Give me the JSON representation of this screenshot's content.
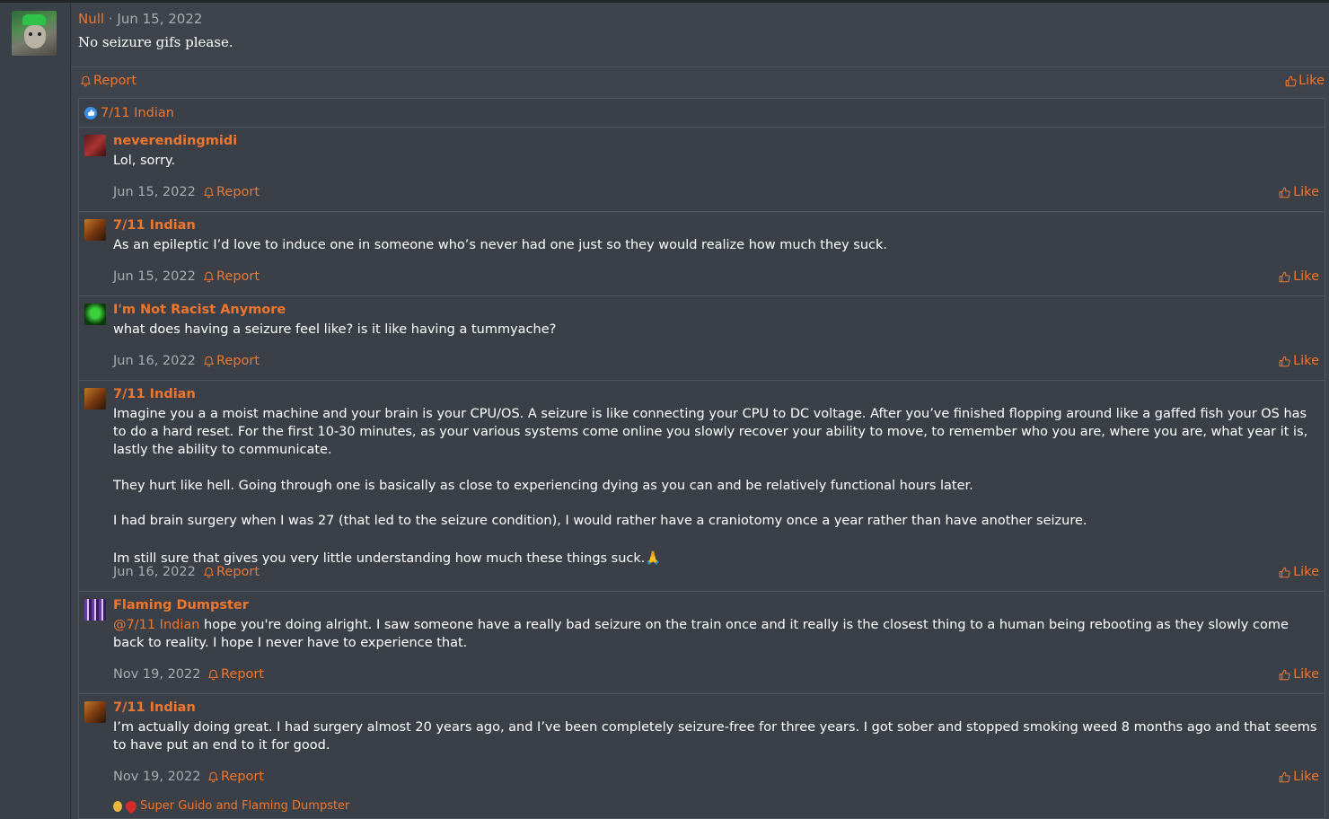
{
  "post": {
    "author": "Null",
    "separator": "·",
    "date": "Jun 15, 2022",
    "body": "No seizure gifs please.",
    "report_label": "Report",
    "like_label": "Like"
  },
  "reactions_header": {
    "icon": "thumbs-up-icon",
    "reactor": "7/11 Indian"
  },
  "replies": [
    {
      "author": "neverendingmidi",
      "text": [
        "Lol, sorry."
      ],
      "date": "Jun 15, 2022",
      "report_label": "Report",
      "like_label": "Like"
    },
    {
      "author": "7/11 Indian",
      "text": [
        "As an epileptic I’d love to induce one in someone who’s never had one just so they would realize how much they suck."
      ],
      "date": "Jun 15, 2022",
      "report_label": "Report",
      "like_label": "Like"
    },
    {
      "author": "I'm Not Racist Anymore",
      "text": [
        "what does having a seizure feel like? is it like having a tummyache?"
      ],
      "date": "Jun 16, 2022",
      "report_label": "Report",
      "like_label": "Like"
    },
    {
      "author": "7/11 Indian",
      "text": [
        "Imagine you a a moist machine and your brain is your CPU/OS. A seizure is like connecting your CPU to DC voltage. After you’ve finished flopping around like a gaffed fish your OS has to do a hard reset. For the first 10-30 minutes, as your various systems come online you slowly recover your ability to move, to remember who you are, where you are, what year it is, lastly the ability to communicate.",
        "They hurt like hell. Going through one is basically as close to experiencing dying as you can and be relatively functional hours later.",
        "I had brain surgery when I was 27 (that led to the seizure condition), I would rather have a craniotomy once a year rather than have another seizure.",
        "Im still sure that gives you very little understanding how much these things suck.🙏"
      ],
      "date": "Jun 16, 2022",
      "report_label": "Report",
      "like_label": "Like"
    },
    {
      "author": "Flaming Dumpster",
      "mention": "@7/11 Indian",
      "text": [
        " hope you're doing alright. I saw someone have a really bad seizure on the train once and it really is the closest thing to a human being rebooting as they slowly come back to reality. I hope I never have to experience that."
      ],
      "date": "Nov 19, 2022",
      "report_label": "Report",
      "like_label": "Like"
    },
    {
      "author": "7/11 Indian",
      "text": [
        "I’m actually doing great. I had surgery almost 20 years ago, and I’ve been completely seizure-free for three years. I got sober and stopped smoking weed 8 months ago and that seems to have put an end to it for good."
      ],
      "date": "Nov 19, 2022",
      "report_label": "Report",
      "like_label": "Like",
      "reactors": "Super Guido and Flaming Dumpster"
    }
  ],
  "colors": {
    "accent": "#f0762c",
    "background": "#3f444c",
    "text": "#ffffff",
    "muted": "#a7adb3"
  }
}
